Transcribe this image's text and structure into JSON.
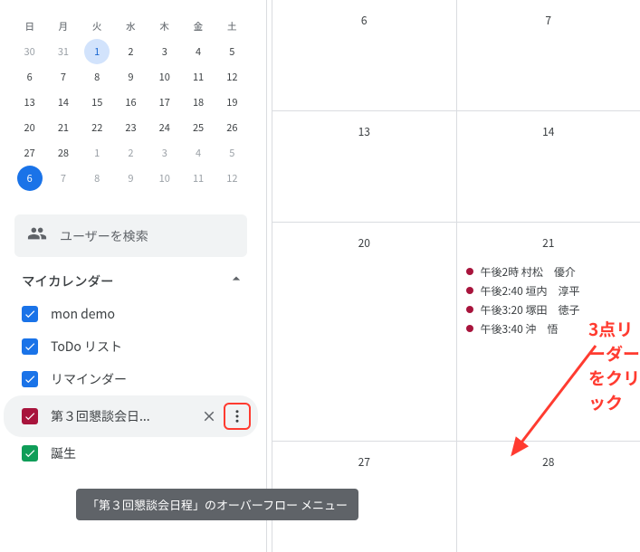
{
  "mini_calendar": {
    "dow": [
      "日",
      "月",
      "火",
      "水",
      "木",
      "金",
      "土"
    ],
    "rows": [
      [
        {
          "n": "30",
          "dim": true
        },
        {
          "n": "31",
          "dim": true
        },
        {
          "n": "1",
          "ring": true
        },
        {
          "n": "2"
        },
        {
          "n": "3"
        },
        {
          "n": "4"
        },
        {
          "n": "5"
        }
      ],
      [
        {
          "n": "6"
        },
        {
          "n": "7"
        },
        {
          "n": "8"
        },
        {
          "n": "9"
        },
        {
          "n": "10"
        },
        {
          "n": "11"
        },
        {
          "n": "12"
        }
      ],
      [
        {
          "n": "13"
        },
        {
          "n": "14"
        },
        {
          "n": "15"
        },
        {
          "n": "16"
        },
        {
          "n": "17"
        },
        {
          "n": "18"
        },
        {
          "n": "19"
        }
      ],
      [
        {
          "n": "20"
        },
        {
          "n": "21"
        },
        {
          "n": "22"
        },
        {
          "n": "23"
        },
        {
          "n": "24"
        },
        {
          "n": "25"
        },
        {
          "n": "26"
        }
      ],
      [
        {
          "n": "27"
        },
        {
          "n": "28"
        },
        {
          "n": "1",
          "dim": true
        },
        {
          "n": "2",
          "dim": true
        },
        {
          "n": "3",
          "dim": true
        },
        {
          "n": "4",
          "dim": true
        },
        {
          "n": "5",
          "dim": true
        }
      ],
      [
        {
          "n": "6",
          "filled": true
        },
        {
          "n": "7",
          "dim": true
        },
        {
          "n": "8",
          "dim": true
        },
        {
          "n": "9",
          "dim": true
        },
        {
          "n": "10",
          "dim": true
        },
        {
          "n": "11",
          "dim": true
        },
        {
          "n": "12",
          "dim": true
        }
      ]
    ]
  },
  "search": {
    "label": "ユーザーを検索"
  },
  "section": {
    "title": "マイカレンダー"
  },
  "calendars": [
    {
      "label": "mon demo",
      "color": "#1a73e8"
    },
    {
      "label": "ToDo リスト",
      "color": "#1a73e8"
    },
    {
      "label": "リマインダー",
      "color": "#1a73e8"
    },
    {
      "label": "第３回懇談会日...",
      "color": "#a8143c",
      "hover": true
    },
    {
      "label": "誕生",
      "color": "#0f9d58",
      "truncated": true
    }
  ],
  "tooltip": "「第３回懇談会日程」のオーバーフロー メニュー",
  "main_days": [
    {
      "num": "6"
    },
    {
      "num": "7"
    },
    {
      "num": "13"
    },
    {
      "num": "14"
    },
    {
      "num": "20"
    },
    {
      "num": "21",
      "events": [
        "午後2時 村松　優介",
        "午後2:40 垣内　淳平",
        "午後3:20 塚田　徳子",
        "午後3:40 沖　悟"
      ]
    },
    {
      "num": "27"
    },
    {
      "num": "28"
    }
  ],
  "annotation": "3点リーダーをクリック"
}
